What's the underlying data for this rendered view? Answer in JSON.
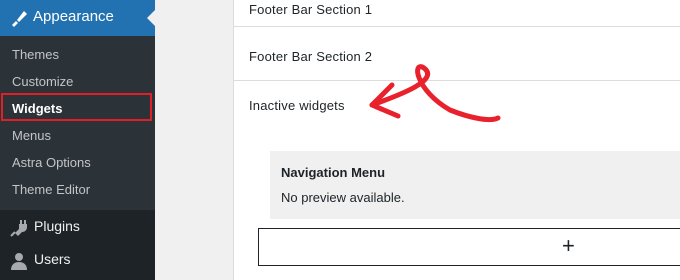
{
  "sidebar": {
    "appearance_label": "Appearance",
    "sub_items": [
      "Themes",
      "Customize",
      "Widgets",
      "Menus",
      "Astra Options",
      "Theme Editor"
    ],
    "current_item": "Widgets",
    "plugins_label": "Plugins",
    "users_label": "Users"
  },
  "main": {
    "sections": [
      "Footer Bar Section 1",
      "Footer Bar Section 2",
      "Inactive widgets"
    ],
    "widget": {
      "title": "Navigation Menu",
      "description": "No preview available."
    },
    "add_button_label": "+"
  },
  "colors": {
    "accent": "#2271b1",
    "highlight": "#e01f26",
    "annotation_arrow": "#e8212d"
  },
  "icons": [
    "brush-icon",
    "plug-icon",
    "user-icon",
    "plus-icon"
  ]
}
